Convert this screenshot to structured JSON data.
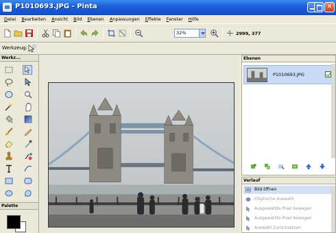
{
  "window": {
    "title": "P1010693.JPG - Pinta"
  },
  "menu": {
    "items": [
      "Datei",
      "Bearbeiten",
      "Ansicht",
      "Bild",
      "Ebenen",
      "Anpassungen",
      "Effekte",
      "Fenster",
      "Hilfe"
    ]
  },
  "toolbar": {
    "zoom_value": "32%",
    "cursor_position": "2999, 377"
  },
  "tool_options": {
    "label": "Werkzeug:"
  },
  "tools_panel": {
    "title": "Werkz..."
  },
  "palette_panel": {
    "title": "Palette",
    "primary_color": "#000000",
    "secondary_color": "#ffffff"
  },
  "layers_panel": {
    "title": "Ebenen",
    "layers": [
      {
        "name": "P1010693.JPG",
        "visible": true
      }
    ]
  },
  "history_panel": {
    "title": "Verlauf",
    "items": [
      {
        "label": "Bild öffnen",
        "state": "current"
      },
      {
        "label": "Elliptische Auswahl",
        "state": "future"
      },
      {
        "label": "Ausgewählte Pixel bewegen",
        "state": "future"
      },
      {
        "label": "Ausgewählte Pixel bewegen",
        "state": "future"
      },
      {
        "label": "Auswahl Zurücksetzen",
        "state": "future"
      }
    ]
  },
  "colors": {
    "titlebar": "#1b5fd9",
    "chrome": "#ece9d8",
    "selection": "#c8daf6"
  }
}
